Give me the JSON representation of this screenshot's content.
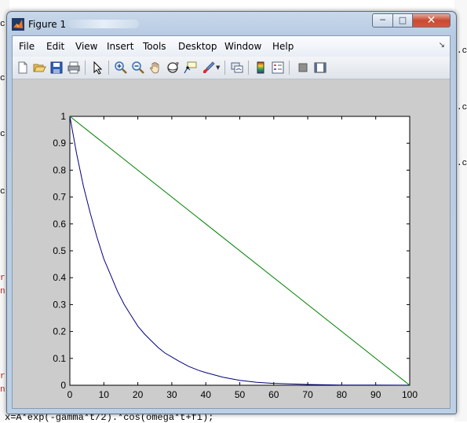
{
  "window": {
    "title": "Figure 1",
    "controls": {
      "minimize": "─",
      "maximize": "□",
      "close": "✕"
    }
  },
  "menubar": {
    "items": [
      "File",
      "Edit",
      "View",
      "Insert",
      "Tools",
      "Desktop",
      "Window",
      "Help"
    ],
    "overflow_icon": "arrow-icon"
  },
  "toolbar": {
    "buttons": [
      "new-figure-icon",
      "open-file-icon",
      "save-icon",
      "print-icon",
      "edit-plot-arrow-icon",
      "zoom-in-icon",
      "zoom-out-icon",
      "pan-hand-icon",
      "rotate-3d-icon",
      "data-cursor-icon",
      "brush-icon",
      "link-plot-icon",
      "colorbar-icon",
      "legend-icon",
      "hide-plot-tools-icon",
      "show-plot-tools-icon"
    ]
  },
  "background_editor": {
    "visible_code": "x=A*exp(-gamma*t/2).*cos(omega*t+fi);",
    "right_marks": [
      ".c",
      ".c",
      ".c"
    ],
    "left_marks": [
      "c",
      "c",
      "c",
      "c",
      "r",
      "n",
      "r",
      "n"
    ]
  },
  "chart_data": {
    "type": "line",
    "title": "",
    "xlabel": "",
    "ylabel": "",
    "xlim": [
      0,
      100
    ],
    "ylim": [
      0,
      1
    ],
    "xticks": [
      "0",
      "10",
      "20",
      "30",
      "40",
      "50",
      "60",
      "70",
      "80",
      "90",
      "100"
    ],
    "yticks": [
      "0",
      "0.1",
      "0.2",
      "0.3",
      "0.4",
      "0.5",
      "0.6",
      "0.7",
      "0.8",
      "0.9",
      "1"
    ],
    "grid": false,
    "legend": "none",
    "series": [
      {
        "color": "#000080",
        "x": [
          0,
          2,
          4,
          6,
          8,
          10,
          12,
          14,
          16,
          18,
          20,
          22,
          24,
          26,
          28,
          30,
          32,
          35,
          38,
          40,
          45,
          50,
          55,
          60,
          70,
          80,
          90,
          100
        ],
        "y": [
          1.0,
          0.86,
          0.74,
          0.64,
          0.55,
          0.47,
          0.41,
          0.35,
          0.3,
          0.26,
          0.22,
          0.19,
          0.165,
          0.14,
          0.12,
          0.105,
          0.09,
          0.07,
          0.055,
          0.047,
          0.03,
          0.018,
          0.011,
          0.007,
          0.003,
          0.001,
          0.0005,
          0.0002
        ]
      },
      {
        "color": "#008000",
        "x": [
          0,
          100
        ],
        "y": [
          1.0,
          0.0
        ]
      }
    ]
  }
}
